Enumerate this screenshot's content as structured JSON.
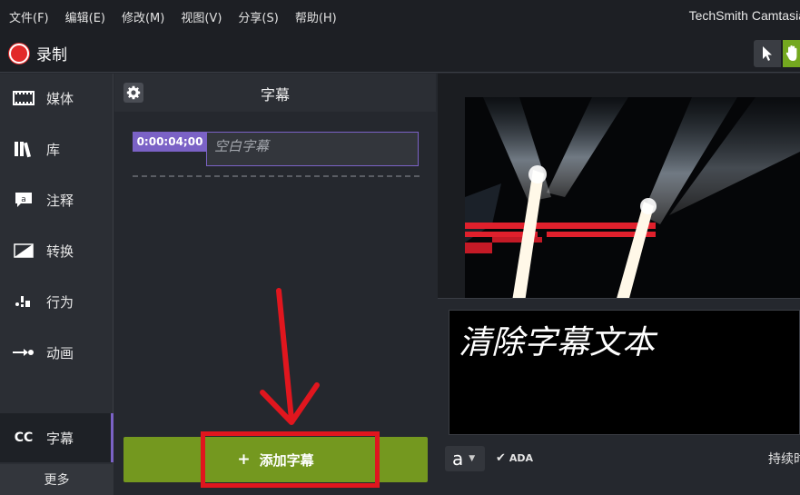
{
  "menu": {
    "items": [
      "文件(F)",
      "编辑(E)",
      "修改(M)",
      "视图(V)",
      "分享(S)",
      "帮助(H)"
    ],
    "app_title": "TechSmith Camtasia"
  },
  "toolbar": {
    "record_label": "录制",
    "pointer_icon": "pointer-icon",
    "hand_icon": "hand-icon"
  },
  "nav": {
    "items": [
      {
        "label": "媒体",
        "icon": "film-icon"
      },
      {
        "label": "库",
        "icon": "library-icon"
      },
      {
        "label": "注释",
        "icon": "annotation-icon"
      },
      {
        "label": "转换",
        "icon": "transition-icon"
      },
      {
        "label": "行为",
        "icon": "behavior-icon"
      },
      {
        "label": "动画",
        "icon": "animation-icon"
      }
    ],
    "captions": {
      "label": "字幕",
      "icon_text": "CC"
    },
    "more": "更多"
  },
  "panel": {
    "title": "字幕",
    "caption": {
      "time": "0:00:04;00",
      "text": "空白字幕"
    },
    "add_button": {
      "plus": "+",
      "label": "添加字幕"
    }
  },
  "preview": {
    "caption_text": "清除字幕文本",
    "font_glyph": "a",
    "ada_label": "ADA",
    "duration_label": "持续时间"
  },
  "colors": {
    "accent_purple": "#7b62c6",
    "accent_green": "#74981f",
    "record_red": "#e22a2a",
    "annotation_red": "#e0161e"
  }
}
